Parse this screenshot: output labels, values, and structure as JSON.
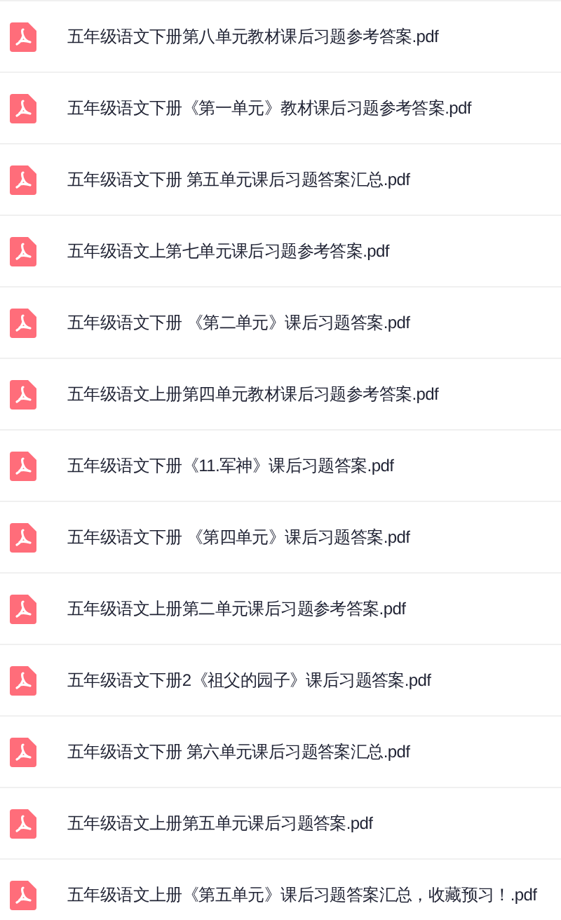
{
  "files": [
    {
      "name": "五年级语文下册第八单元教材课后习题参考答案.pdf"
    },
    {
      "name": "五年级语文下册《第一单元》教材课后习题参考答案.pdf"
    },
    {
      "name": "五年级语文下册 第五单元课后习题答案汇总.pdf"
    },
    {
      "name": "五年级语文上第七单元课后习题参考答案.pdf"
    },
    {
      "name": "五年级语文下册 《第二单元》课后习题答案.pdf"
    },
    {
      "name": "五年级语文上册第四单元教材课后习题参考答案.pdf"
    },
    {
      "name": "五年级语文下册《11.军神》课后习题答案.pdf"
    },
    {
      "name": "五年级语文下册 《第四单元》课后习题答案.pdf"
    },
    {
      "name": "五年级语文上册第二单元课后习题参考答案.pdf"
    },
    {
      "name": "五年级语文下册2《祖父的园子》课后习题答案.pdf"
    },
    {
      "name": "五年级语文下册 第六单元课后习题答案汇总.pdf"
    },
    {
      "name": "五年级语文上册第五单元课后习题答案.pdf"
    },
    {
      "name": "五年级语文上册《第五单元》课后习题答案汇总，收藏预习！.pdf"
    }
  ]
}
